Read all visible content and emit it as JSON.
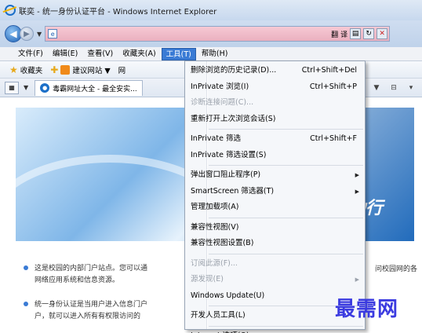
{
  "window": {
    "title": "联奕 - 统一身份认证平台 - Windows Internet Explorer"
  },
  "address": {
    "right_labels": [
      "翻",
      "译"
    ]
  },
  "menubar": {
    "items": [
      "文件(F)",
      "编辑(E)",
      "查看(V)",
      "收藏夹(A)",
      "工具(T)",
      "帮助(H)"
    ],
    "active": "工具(T)"
  },
  "favbar": {
    "favorites_label": "收藏夹",
    "suggested_label": "建议网站 ▼",
    "web_slice_label": "网"
  },
  "tabs": {
    "items": [
      "毒霸网址大全 - 最全安实..."
    ]
  },
  "content": {
    "banner_text": "动行",
    "para1_line1": "这是校园的内部门户站点。您可以通",
    "para1_line2": "网络应用系统和信息资源。",
    "para1_right": "问校园网的各",
    "para2_line1": "统一身份认证是当用户进入信息门户",
    "para2_line2": "户，就可以进入所有有权限访问的"
  },
  "tools_menu": {
    "items": [
      {
        "label": "删除浏览的历史记录(D)...",
        "shortcut": "Ctrl+Shift+Del",
        "disabled": false,
        "submenu": false
      },
      {
        "label": "InPrivate 浏览(I)",
        "shortcut": "Ctrl+Shift+P",
        "disabled": false,
        "submenu": false
      },
      {
        "label": "诊断连接问题(C)...",
        "shortcut": "",
        "disabled": true,
        "submenu": false
      },
      {
        "label": "重新打开上次浏览会话(S)",
        "shortcut": "",
        "disabled": false,
        "submenu": false
      },
      {
        "sep": true
      },
      {
        "label": "InPrivate 筛选",
        "shortcut": "Ctrl+Shift+F",
        "disabled": false,
        "submenu": false
      },
      {
        "label": "InPrivate 筛选设置(S)",
        "shortcut": "",
        "disabled": false,
        "submenu": false
      },
      {
        "sep": true
      },
      {
        "label": "弹出窗口阻止程序(P)",
        "shortcut": "",
        "disabled": false,
        "submenu": true
      },
      {
        "label": "SmartScreen 筛选器(T)",
        "shortcut": "",
        "disabled": false,
        "submenu": true
      },
      {
        "label": "管理加载项(A)",
        "shortcut": "",
        "disabled": false,
        "submenu": false
      },
      {
        "sep": true
      },
      {
        "label": "兼容性视图(V)",
        "shortcut": "",
        "disabled": false,
        "submenu": false
      },
      {
        "label": "兼容性视图设置(B)",
        "shortcut": "",
        "disabled": false,
        "submenu": false
      },
      {
        "sep": true
      },
      {
        "label": "订阅此源(F)...",
        "shortcut": "",
        "disabled": true,
        "submenu": false
      },
      {
        "label": "源发现(E)",
        "shortcut": "",
        "disabled": true,
        "submenu": true
      },
      {
        "label": "Windows Update(U)",
        "shortcut": "",
        "disabled": false,
        "submenu": false
      },
      {
        "sep": true
      },
      {
        "label": "开发人员工具(L)",
        "shortcut": "",
        "disabled": false,
        "submenu": false
      },
      {
        "sep": true
      },
      {
        "label": "Internet 选项(O)",
        "shortcut": "",
        "disabled": false,
        "submenu": false
      }
    ]
  },
  "watermark": "最需网"
}
